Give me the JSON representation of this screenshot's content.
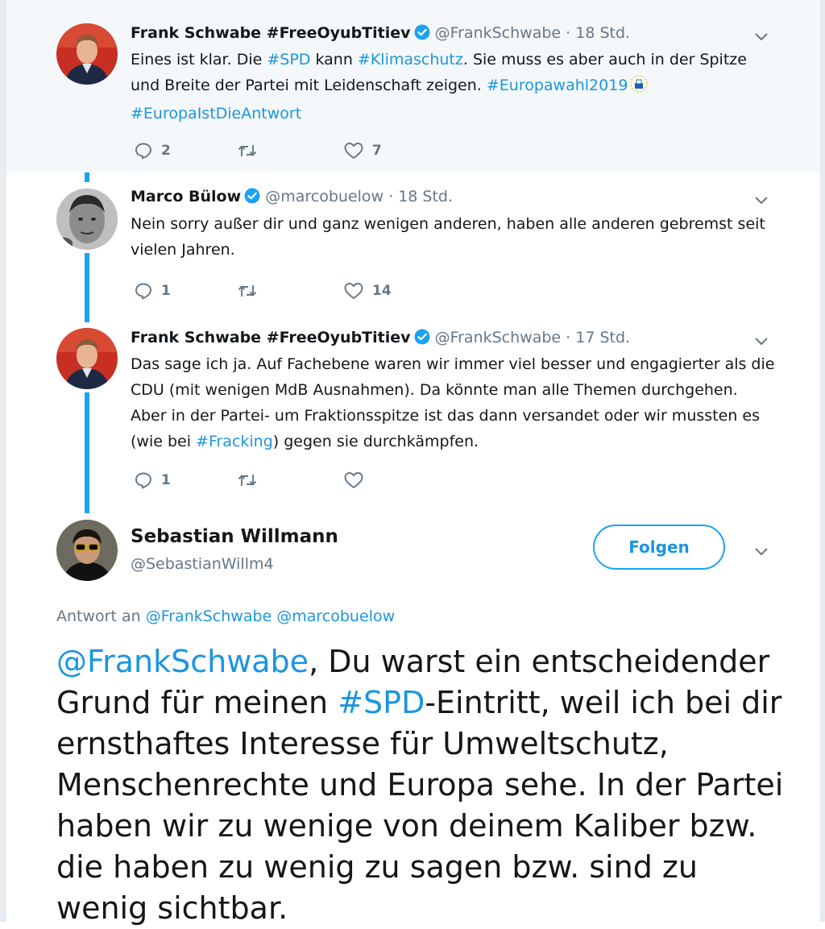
{
  "thread": [
    {
      "author_name": "Frank Schwabe #FreeOyubTitiev",
      "author_handle": "@FrankSchwabe",
      "separator": "·",
      "time": "18 Std.",
      "text_parts": [
        {
          "t": "Eines ist klar. Die ",
          "link": false
        },
        {
          "t": "#SPD",
          "link": true
        },
        {
          "t": " kann ",
          "link": false
        },
        {
          "t": "#Klimaschutz",
          "link": true
        },
        {
          "t": ". Sie muss es aber auch in der Spitze und Breite der Partei mit Leidenschaft zeigen. ",
          "link": false
        },
        {
          "t": "#Europawahl2019",
          "link": true
        },
        {
          "t": " ",
          "link": false
        },
        {
          "t": "#EuropaIstDieAntwort",
          "link": true
        }
      ],
      "reply_count": "2",
      "retweet_count": "",
      "like_count": "7"
    },
    {
      "author_name": "Marco Bülow",
      "author_handle": "@marcobuelow",
      "separator": "·",
      "time": "18 Std.",
      "text_parts": [
        {
          "t": "Nein sorry außer dir und ganz wenigen anderen, haben alle anderen gebremst seit vielen Jahren.",
          "link": false
        }
      ],
      "reply_count": "1",
      "retweet_count": "",
      "like_count": "14"
    },
    {
      "author_name": "Frank Schwabe #FreeOyubTitiev",
      "author_handle": "@FrankSchwabe",
      "separator": "·",
      "time": "17 Std.",
      "text_parts": [
        {
          "t": "Das sage ich ja. Auf Fachebene waren wir immer viel besser und engagierter als die CDU (mit wenigen MdB Ausnahmen). Da könnte man alle Themen durchgehen. Aber in der Partei- um Fraktionsspitze ist das dann versandet oder wir mussten es (wie bei ",
          "link": false
        },
        {
          "t": "#Fracking",
          "link": true
        },
        {
          "t": ") gegen sie durchkämpfen.",
          "link": false
        }
      ],
      "reply_count": "1",
      "retweet_count": "",
      "like_count": ""
    }
  ],
  "main_tweet": {
    "author_name": "Sebastian Willmann",
    "author_handle": "@SebastianWillm4",
    "follow_label": "Folgen",
    "reply_to_prefix": "Antwort an",
    "reply_to_handles": "@FrankSchwabe @marcobuelow",
    "text_parts": [
      {
        "t": "@FrankSchwabe",
        "link": true
      },
      {
        "t": ", Du warst ein entscheidender Grund für meinen ",
        "link": false
      },
      {
        "t": "#SPD",
        "link": true
      },
      {
        "t": "-Eintritt, weil ich bei dir ernsthaftes Interesse für Umweltschutz, Menschenrechte und Europa sehe. In der Partei haben wir zu wenige von deinem Kaliber bzw. die haben zu wenig zu sagen bzw. sind zu wenig sichtbar.",
        "link": false
      }
    ]
  },
  "colors": {
    "accent": "#1da1f2",
    "link": "#1b95e0",
    "muted": "#657786",
    "highlight_bg": "#f5f8fa"
  },
  "icons": {
    "reply": "reply-icon",
    "retweet": "retweet-icon",
    "like": "heart-icon",
    "verified": "verified-badge-icon",
    "menu": "chevron-down-icon",
    "ballot": "ballot-box-emoji-icon"
  }
}
